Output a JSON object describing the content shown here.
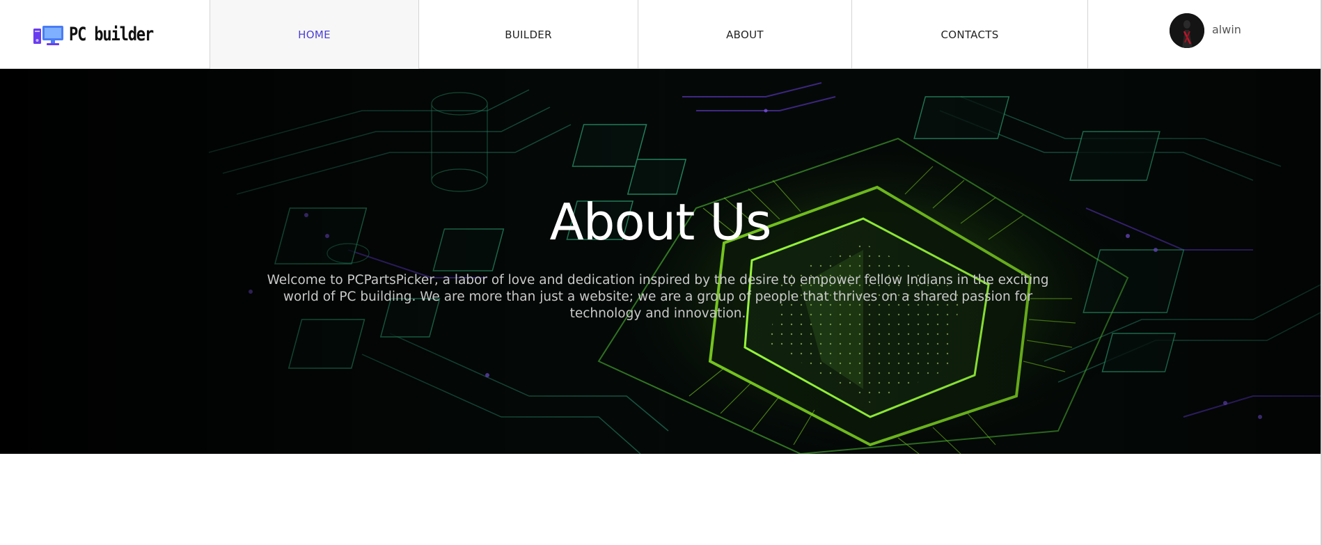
{
  "brand": {
    "name": "PC builder",
    "logo_icon": "pc-logo-icon"
  },
  "nav": {
    "items": [
      {
        "label": "HOME",
        "active": true
      },
      {
        "label": "BUILDER",
        "active": false
      },
      {
        "label": "ABOUT",
        "active": false
      },
      {
        "label": "CONTACTS",
        "active": false
      }
    ],
    "active_color": "#4b3fd6"
  },
  "user": {
    "name": "alwin",
    "avatar_icon": "user-avatar"
  },
  "hero": {
    "title": "About Us",
    "description": "Welcome to PCPartsPicker, a labor of love and dedication inspired by the desire to empower fellow Indians in the exciting world of PC building. We are more than just a website; we are a group of people that thrives on a shared passion for technology and innovation.",
    "accent_green": "#7ed321",
    "accent_purple": "#7b4dff"
  }
}
